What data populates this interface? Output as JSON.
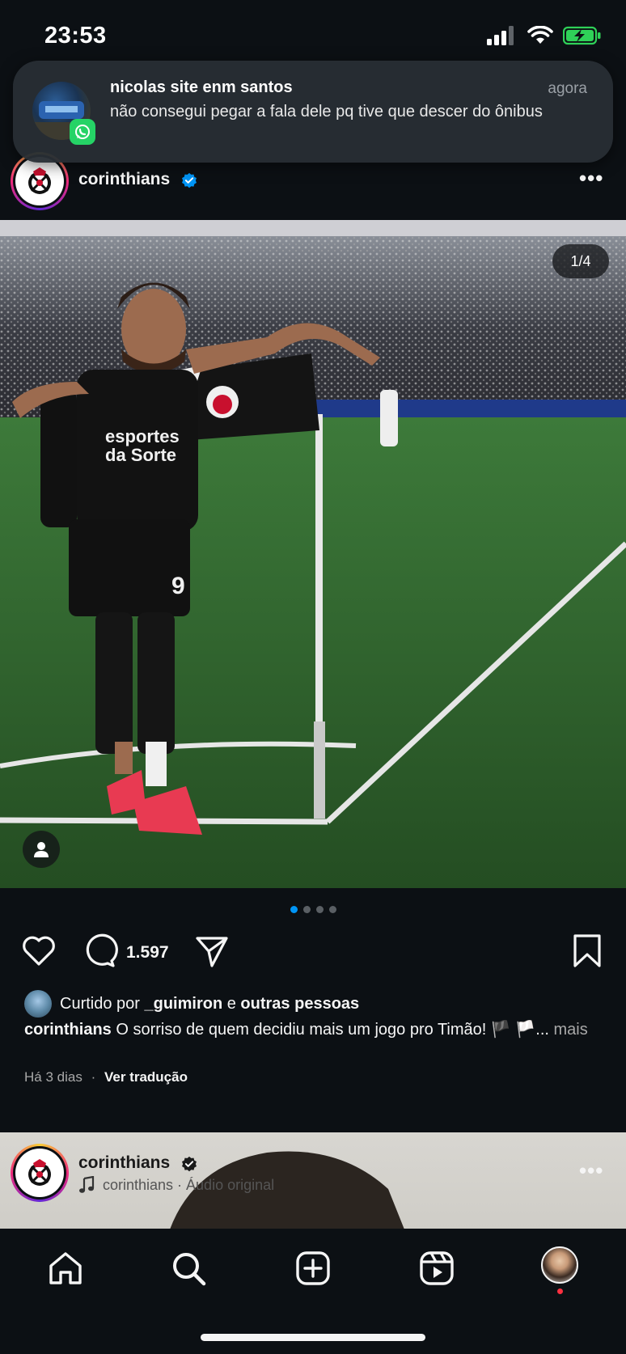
{
  "status_bar": {
    "time": "23:53"
  },
  "notification": {
    "sender": "nicolas site enm santos",
    "time": "agora",
    "message": "não consegui pegar a fala dele pq tive que descer do ônibus",
    "app_icon": "whatsapp-icon"
  },
  "post": {
    "username": "corinthians",
    "verified": true,
    "photo_counter": "1/4",
    "carousel_total": 4,
    "carousel_active": 1,
    "comments_count": "1.597",
    "liked_by_prefix": "Curtido por",
    "liked_by_user": "_guimiron",
    "liked_by_and": "e",
    "liked_by_others": "outras pessoas",
    "caption_user": "corinthians",
    "caption_text": "O sorriso de quem decidiu mais um jogo pro Timão! 🏴 🏳️",
    "caption_ellipsis": "...",
    "caption_more": "mais",
    "time_ago": "Há 3 dias",
    "separator": "·",
    "translate_label": "Ver tradução"
  },
  "next_post": {
    "username": "corinthians",
    "audio_text": "corinthians · Áudio original"
  },
  "colors": {
    "background": "#0c1014",
    "accent_blue": "#0095f6",
    "whatsapp": "#25d366",
    "notification_dot": "#ff3040"
  },
  "nav": [
    "home-icon",
    "search-icon",
    "create-icon",
    "reels-icon",
    "profile-avatar"
  ]
}
